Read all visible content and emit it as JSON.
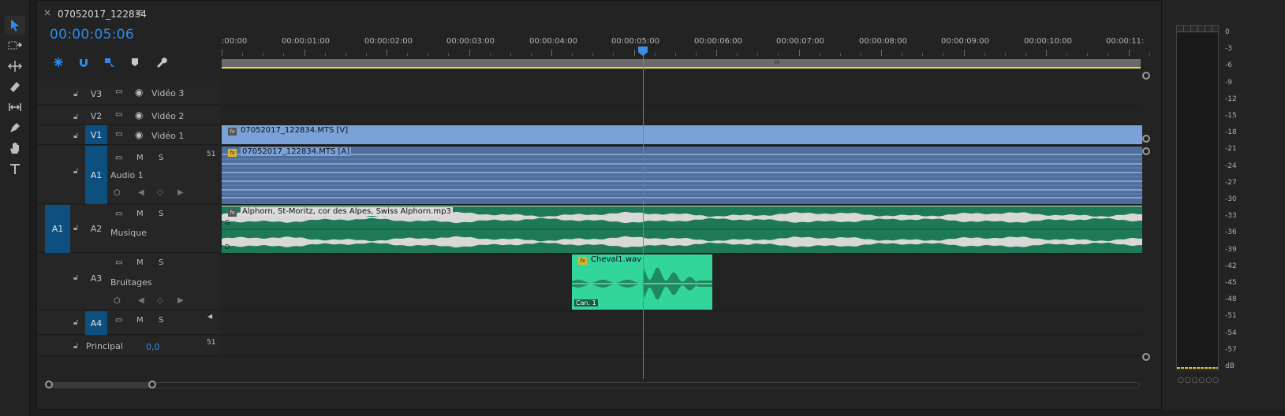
{
  "sequence": {
    "tab_title": "07052017_122834",
    "timecode": "00:00:05:06"
  },
  "ruler": {
    "labels": [
      ":00:00",
      "00:00:01:00",
      "00:00:02:00",
      "00:00:03:00",
      "00:00:04:00",
      "00:00:05:00",
      "00:00:06:00",
      "00:00:07:00",
      "00:00:08:00",
      "00:00:09:00",
      "00:00:10:00",
      "00:00:11:"
    ],
    "workbar_grip": "III"
  },
  "tracks": {
    "v3": {
      "id": "V3",
      "name": "Vidéo 3"
    },
    "v2": {
      "id": "V2",
      "name": "Vidéo 2"
    },
    "v1": {
      "id": "V1",
      "name": "Vidéo 1"
    },
    "a1": {
      "id": "A1",
      "name": "Audio 1",
      "m": "M",
      "s": "S",
      "ch": "51"
    },
    "a2": {
      "id": "A2",
      "name": "Musique",
      "src": "A1",
      "m": "M",
      "s": "S"
    },
    "a3": {
      "id": "A3",
      "name": "Bruitages",
      "m": "M",
      "s": "S"
    },
    "a4": {
      "id": "A4",
      "m": "M",
      "s": "S"
    },
    "master": {
      "name": "Principal",
      "value": "0,0",
      "ch": "51"
    }
  },
  "clips": {
    "video": {
      "label": "07052017_122834.MTS [V]"
    },
    "audio": {
      "label": "07052017_122834.MTS [A]",
      "fx": "fx"
    },
    "music": {
      "label": "Alphorn, St-Moritz, cor des Alpes, Swiss Alphorn.mp3",
      "fx": "fx",
      "left_ch": "G",
      "right_ch": "D"
    },
    "sfx": {
      "label": "Cheval1.wav",
      "fx": "fx",
      "channel": "Can. 1"
    }
  },
  "meter": {
    "scale": [
      "0",
      "-3",
      "-6",
      "-9",
      "-12",
      "-15",
      "-18",
      "-21",
      "-24",
      "-27",
      "-30",
      "-33",
      "-36",
      "-39",
      "-42",
      "-45",
      "-48",
      "-51",
      "-54",
      "-57",
      "dB"
    ],
    "footer": "○○○○○○"
  },
  "colors": {
    "accent": "#2d8ceb",
    "video_clip": "#7aa2d8",
    "music_clip": "#1e7a56",
    "sfx_clip": "#33d69a",
    "workarea": "#e7d640"
  }
}
